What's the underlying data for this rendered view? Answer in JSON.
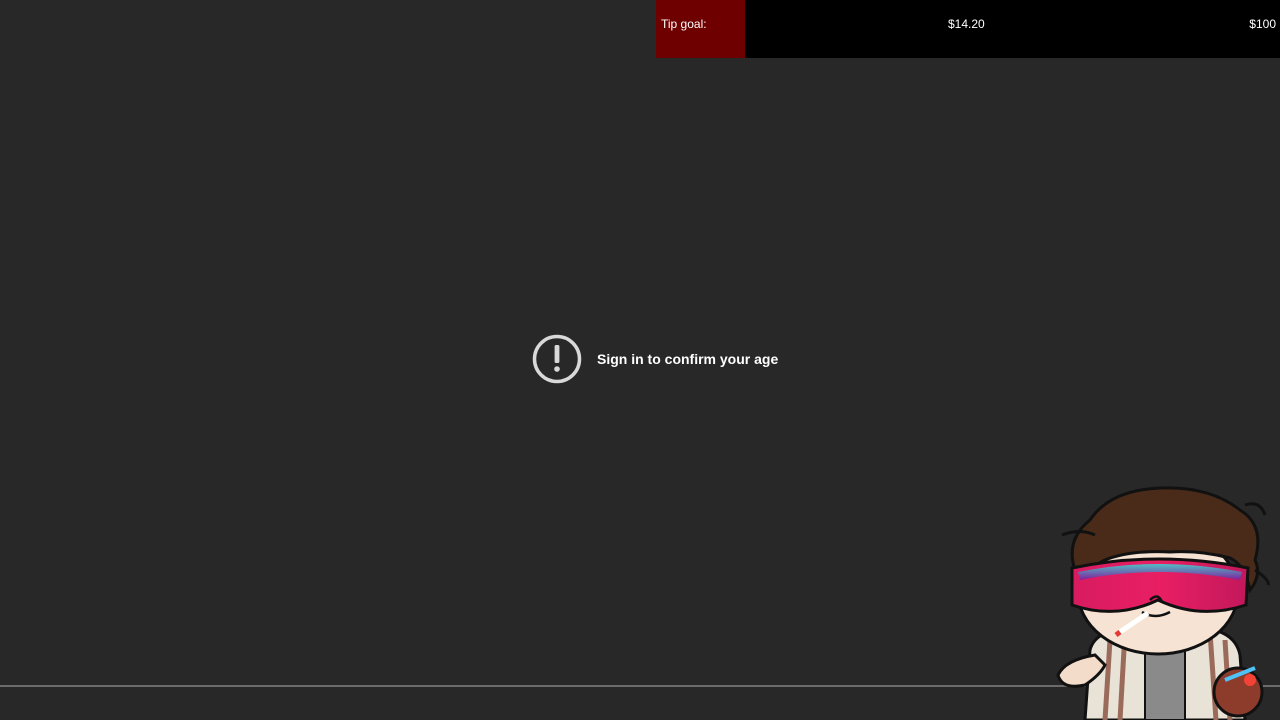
{
  "tip_goal": {
    "label": "Tip goal:",
    "current": "$14.20",
    "target": "$100",
    "progress": 0.142,
    "fill_color": "#6e0000",
    "track_color": "#000000"
  },
  "age_gate": {
    "icon": "alert-circle-icon",
    "message": "Sign in to confirm your age"
  },
  "overlay": {
    "mascot": "cartoon-character-with-visor-glasses"
  },
  "colors": {
    "background": "#282828",
    "text": "#ffffff",
    "icon": "#d9d9d9"
  }
}
